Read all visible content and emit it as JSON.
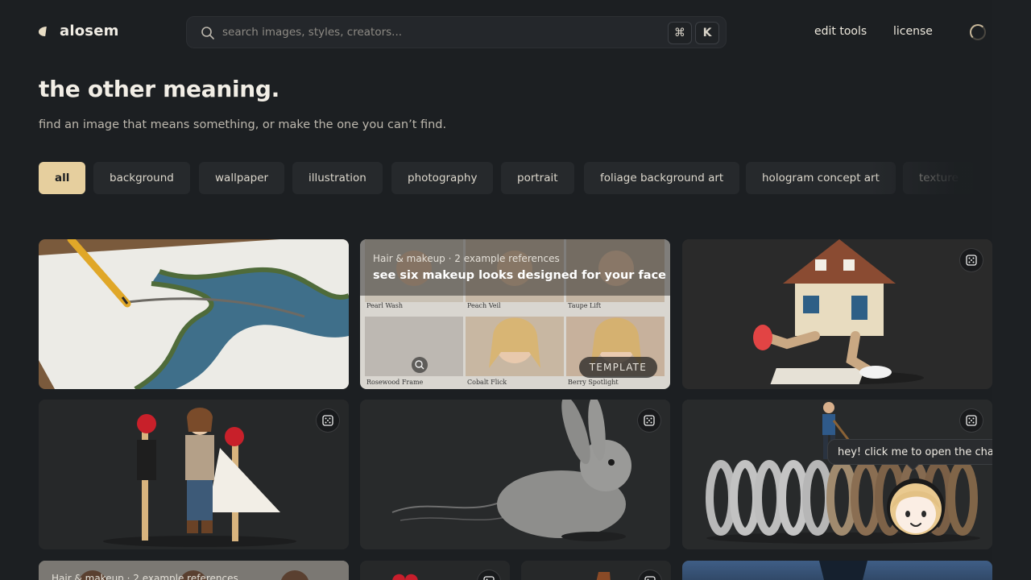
{
  "brand": {
    "name": "alosem"
  },
  "search": {
    "placeholder": "search images, styles, creators...",
    "value": "",
    "shortcut_cmd": "⌘",
    "shortcut_key": "K"
  },
  "nav": {
    "edit_tools": "edit tools",
    "license": "license"
  },
  "hero": {
    "title": "the other meaning.",
    "subtitle": "find an image that means something, or make the one you can’t find."
  },
  "chips": [
    {
      "label": "all",
      "active": true
    },
    {
      "label": "background",
      "active": false
    },
    {
      "label": "wallpaper",
      "active": false
    },
    {
      "label": "illustration",
      "active": false
    },
    {
      "label": "photography",
      "active": false
    },
    {
      "label": "portrait",
      "active": false
    },
    {
      "label": "foliage background art",
      "active": false
    },
    {
      "label": "hologram concept art",
      "active": false
    },
    {
      "label": "texture",
      "active": false
    }
  ],
  "cards": {
    "template1": {
      "meta": "Hair & makeup · 2 example references",
      "title": "see six makeup looks designed for your face",
      "badge": "TEMPLATE",
      "labels": [
        "Pearl Wash",
        "Peach Veil",
        "Taupe Lift",
        "Rosewood Frame",
        "Cobalt Flick",
        "Berry Spotlight"
      ]
    },
    "template2": {
      "meta": "Hair & makeup · 2 example references"
    }
  },
  "chat": {
    "message": "hey! click me to open the chat 👋"
  },
  "colors": {
    "accent": "#e6cf9e",
    "background": "#1c1f22",
    "card": "#262829"
  }
}
